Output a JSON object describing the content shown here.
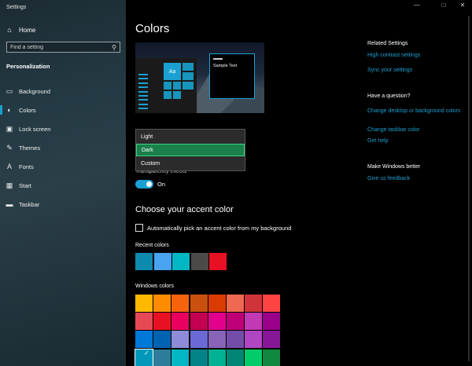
{
  "window": {
    "title": "Settings",
    "min": "—",
    "max": "□",
    "close": "✕"
  },
  "sidebar": {
    "home_label": "Home",
    "search_placeholder": "Find a setting",
    "section": "Personalization",
    "items": [
      {
        "label": "Background",
        "icon": "image-icon",
        "glyph": "▭"
      },
      {
        "label": "Colors",
        "icon": "palette-icon",
        "glyph": "◐"
      },
      {
        "label": "Lock screen",
        "icon": "lock-screen-icon",
        "glyph": "▣"
      },
      {
        "label": "Themes",
        "icon": "themes-icon",
        "glyph": "✎"
      },
      {
        "label": "Fonts",
        "icon": "fonts-icon",
        "glyph": "A"
      },
      {
        "label": "Start",
        "icon": "start-icon",
        "glyph": "▦"
      },
      {
        "label": "Taskbar",
        "icon": "taskbar-icon",
        "glyph": "▬"
      }
    ],
    "active_item": "Colors"
  },
  "main": {
    "title": "Colors",
    "preview": {
      "tile_text": "Aa",
      "sample_text": "Sample Text"
    },
    "mode_options": [
      "Light",
      "Dark",
      "Custom"
    ],
    "mode_selected": "Dark",
    "transparency_label": "Transparency effects",
    "transparency_state": "On",
    "accent_heading": "Choose your accent color",
    "auto_pick_label": "Automatically pick an accent color from my background",
    "auto_pick_checked": false,
    "recent_label": "Recent colors",
    "recent_colors": [
      "#0e8aad",
      "#4aa3f0",
      "#00b7c3",
      "#4c4a48",
      "#e81123"
    ],
    "windows_label": "Windows colors",
    "windows_colors": [
      [
        "#ffb900",
        "#ff8c00",
        "#f7630c",
        "#ca5010",
        "#da3b01",
        "#ef6950",
        "#d13438",
        "#ff4343"
      ],
      [
        "#e74856",
        "#e81123",
        "#ea005e",
        "#c30052",
        "#e3008c",
        "#bf0077",
        "#c239b3",
        "#9a0089"
      ],
      [
        "#0078d7",
        "#0063b1",
        "#8e8cd8",
        "#6b69d6",
        "#8764b8",
        "#744da9",
        "#b146c2",
        "#881798"
      ],
      [
        "#0099bc",
        "#2d7d9a",
        "#00b7c3",
        "#038387",
        "#00b294",
        "#018574",
        "#00cc6a",
        "#10893e"
      ]
    ],
    "selected_color": "#0099bc"
  },
  "right": {
    "related_heading": "Related Settings",
    "related_links": [
      "High contrast settings",
      "Sync your settings"
    ],
    "question_heading": "Have a question?",
    "question_links": [
      "Change desktop or background colors",
      "Change taskbar color",
      "Get help"
    ],
    "better_heading": "Make Windows better",
    "better_links": [
      "Give us feedback"
    ]
  },
  "colors": {
    "accent": "#1aa1d1",
    "selection": "#1a7f4a"
  }
}
